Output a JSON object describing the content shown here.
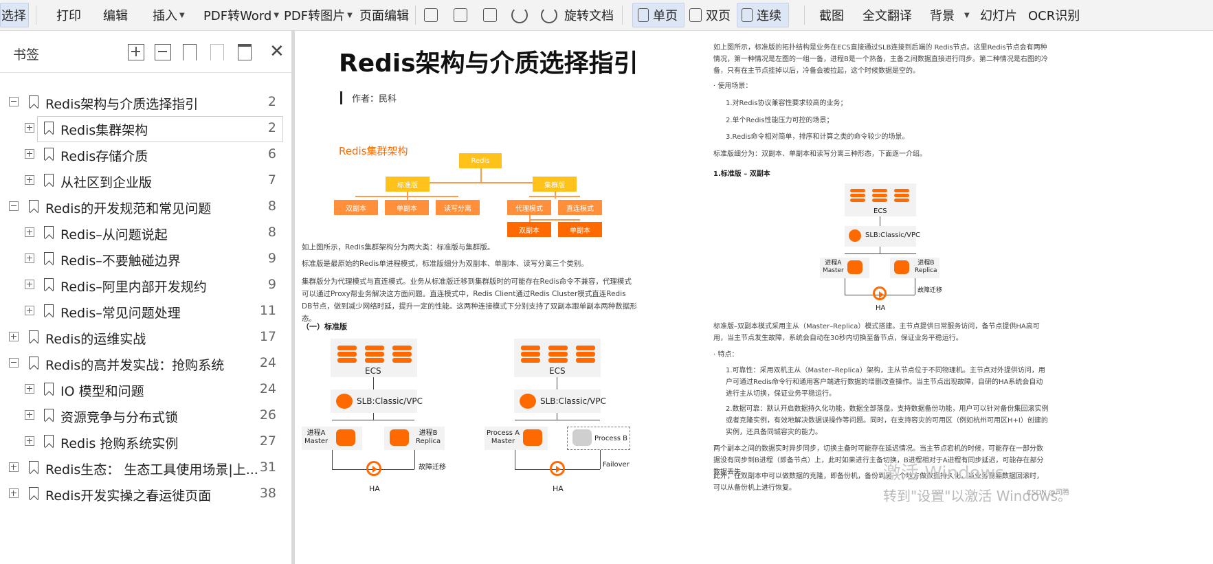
{
  "toolbar": {
    "select": "选择",
    "print": "打印",
    "edit": "编辑",
    "insert": "插入",
    "pdf_to_word": "PDF转Word",
    "pdf_to_image": "PDF转图片",
    "page_edit": "页面编辑",
    "rotate_doc": "旋转文档",
    "single_page": "单页",
    "double_page": "双页",
    "continuous": "连续",
    "screenshot": "截图",
    "full_translate": "全文翻译",
    "background": "背景",
    "slideshow": "幻灯片",
    "ocr": "OCR识别"
  },
  "sidebar": {
    "title": "书签",
    "items": [
      {
        "label": "Redis架构与介质选择指引",
        "page": "2",
        "level": 0,
        "expanded": true
      },
      {
        "label": "Redis集群架构",
        "page": "2",
        "level": 1,
        "expanded": false
      },
      {
        "label": "Redis存储介质",
        "page": "6",
        "level": 1,
        "expanded": false
      },
      {
        "label": "从社区到企业版",
        "page": "7",
        "level": 1,
        "expanded": false
      },
      {
        "label": "Redis的开发规范和常见问题",
        "page": "8",
        "level": 0,
        "expanded": true
      },
      {
        "label": "Redis–从问题说起",
        "page": "8",
        "level": 1,
        "expanded": false
      },
      {
        "label": "Redis–不要触碰边界",
        "page": "9",
        "level": 1,
        "expanded": false
      },
      {
        "label": "Redis–阿里内部开发规约",
        "page": "9",
        "level": 1,
        "expanded": false
      },
      {
        "label": "Redis–常见问题处理",
        "page": "11",
        "level": 1,
        "expanded": false
      },
      {
        "label": "Redis的运维实战",
        "page": "17",
        "level": 0,
        "expanded": false
      },
      {
        "label": "Redis的高并发实战：抢购系统",
        "page": "24",
        "level": 0,
        "expanded": true
      },
      {
        "label": "IO 模型和问题",
        "page": "24",
        "level": 1,
        "expanded": false
      },
      {
        "label": "资源竞争与分布式锁",
        "page": "26",
        "level": 1,
        "expanded": false
      },
      {
        "label": "Redis 抢购系统实例",
        "page": "27",
        "level": 1,
        "expanded": false
      },
      {
        "label": "Redis生态： 生态工具使用场景|上...",
        "page": "31",
        "level": 0,
        "expanded": false
      },
      {
        "label": "Redis开发实操之春运徙页面",
        "page": "38",
        "level": 0,
        "expanded": false
      }
    ]
  },
  "page_left": {
    "title": "Redis架构与介质选择指引",
    "author": "作者：民科",
    "section": "Redis集群架构",
    "tree": {
      "root": "Redis",
      "standard": "标准版",
      "cluster": "集群版",
      "dual": "双副本",
      "single": "单副本",
      "rw": "读写分离",
      "proxy": "代理模式",
      "direct": "直连模式",
      "c_dual": "双副本",
      "c_single": "单副本"
    },
    "para1": "如上图所示，Redis集群架构分为两大类：标准版与集群版。",
    "para2": "标准版是最原始的Redis单进程模式，标准版细分为双副本、单副本、读写分离三个类别。",
    "para3": "集群版分为代理模式与直连模式。业务从标准版迁移到集群版时的可能存在Redis命令不兼容，代理模式可以通过Proxy帮业务解决这方面问题。直连模式中，Redis Client通过Redis Cluster模式直连Redis DB节点，做到减少网络时延，提升一定的性能。这两种连接模式下分别支持了双副本跟单副本两种数据形态。",
    "subheading": "（一）标准版",
    "diag1": {
      "ecs": "ECS",
      "slb": "SLB:Classic/VPC",
      "master": "进程A\nMaster",
      "replica": "进程B\nReplica",
      "failover": "故障迁移",
      "ha": "HA"
    },
    "diag2": {
      "ecs": "ECS",
      "slb": "SLB:Classic/VPC",
      "master": "Process A\nMaster",
      "process_b": "Process B",
      "failover": "Failover",
      "ha": "HA"
    }
  },
  "page_right": {
    "para1": "如上图所示，标准版的拓扑结构是业务在ECS直接通过SLB连接到后端的 Redis节点。这里Redis节点会有两种情况，第一种情况是左图的一组一备，进程B是一个热备，主备之间数据直接进行同步。第二种情况是右图的冷备，只有在主节点挂掉以后，冷备会被拉起，这个时候数据是空的。",
    "usage_title": "· 使用场景：",
    "usage1": "1.对Redis协议兼容性要求较高的业务；",
    "usage2": "2.单个Redis性能压力可控的场景；",
    "usage3": "3.Redis命令相对简单，排序和计算之类的命令较少的场景。",
    "para2": "标准版细分为：双副本、单副本和读写分离三种形态，下面逐一介绍。",
    "h_dual": "1.标准版 – 双副本",
    "diag3": {
      "ecs": "ECS",
      "slb": "SLB:Classic/VPC",
      "master": "进程A\nMaster",
      "replica": "进程B\nReplica",
      "failover": "故障迁移",
      "ha": "HA"
    },
    "para3": "标准版–双副本模式采用主从（Master–Replica）模式搭建。主节点提供日常服务访问，备节点提供HA高可用，当主节点发生故障，系统会自动在30秒内切换至备节点，保证业务平稳运行。",
    "feat_title": "· 特点：",
    "feat1": "1.可靠性：采用双机主从（Master–Replica）架构，主从节点位于不同物理机。主节点对外提供访问，用户可通过Redis命令行和通用客户端进行数据的增删改查操作。当主节点出现故障，自研的HA系统会自动进行主从切换，保证业务平稳运行。",
    "feat2": "2.数据可靠：默认开启数据持久化功能，数据全部落盘。支持数据备份功能，用户可以针对备份集回滚实例或者克隆实例，有效地解决数据误操作等问题。同时，在支持容灾的可用区（例如杭州可用区H+I）创建的实例，还具备同城容灾的能力。",
    "para4": "两个副本之间的数据实时异步同步，切换主备时可能存在延迟情况。当主节点宕机的时候，可能存在一部分数据没有同步到B进程（即备节点）上，此时如果进行主备切换，B进程相对于A进程有同步延迟，可能存在部分数据丢失。",
    "para5": "此外，在双副本中可以做数据的克隆，即备份机，备份到另一个地方做数据持久化，当业务需要数据回滚时，可以从备份机上进行恢复。"
  },
  "watermark": {
    "line1": "激活 Windows",
    "line2": "转到\"设置\"以激活 Windows。",
    "csdn": "CSDN @司腾"
  },
  "colors": {
    "accent": "#ff6a00",
    "gold": "#ffc21a",
    "orange_light": "#ff8f3a",
    "selected_view": "#dde6f4"
  }
}
